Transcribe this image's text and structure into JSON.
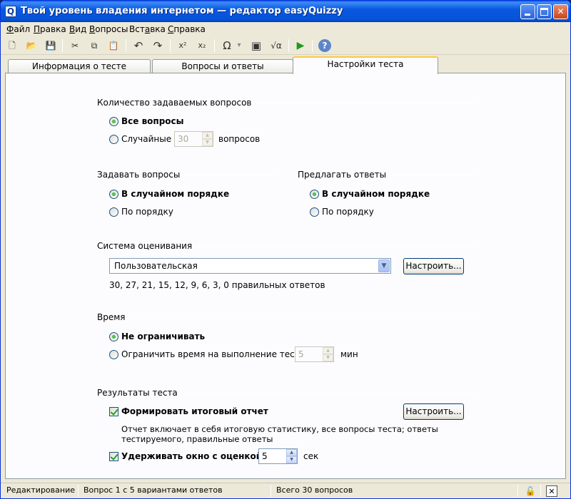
{
  "window": {
    "title": "Твой уровень владения интернетом — редактор easyQuizzy",
    "app_icon_letter": "Q"
  },
  "menu": {
    "items": [
      {
        "prefix": "",
        "ul": "Ф",
        "rest": "айл"
      },
      {
        "prefix": "",
        "ul": "П",
        "rest": "равка"
      },
      {
        "prefix": "",
        "ul": "В",
        "rest": "ид"
      },
      {
        "prefix": "",
        "ul": "В",
        "rest": "опросы"
      },
      {
        "prefix": "Вст",
        "ul": "а",
        "rest": "вка"
      },
      {
        "prefix": "",
        "ul": "С",
        "rest": "правка"
      }
    ]
  },
  "toolbar": {
    "icons": [
      "new-file-icon",
      "open-folder-icon",
      "save-icon",
      "cut-icon",
      "copy-icon",
      "paste-icon",
      "undo-icon",
      "redo-icon",
      "superscript-icon",
      "subscript-icon",
      "omega-symbol-icon",
      "insert-image-icon",
      "formula-icon",
      "run-test-icon",
      "help-icon"
    ],
    "glyphs": {
      "new": "🗋",
      "open": "📂",
      "save": "💾",
      "cut": "✂",
      "copy": "⧉",
      "paste": "📋",
      "undo": "↶",
      "redo": "↷",
      "sup": "x²",
      "sub": "x₂",
      "omega": "Ω",
      "omega_drop": "▾",
      "image": "▣",
      "formula": "√α",
      "run": "▶",
      "help": "?"
    }
  },
  "tabs": [
    {
      "label": "Информация о тесте",
      "active": false
    },
    {
      "label": "Вопросы и ответы",
      "active": false
    },
    {
      "label": "Настройки теста",
      "active": true
    }
  ],
  "settings": {
    "question_count": {
      "title": "Количество задаваемых вопросов",
      "all_label": "Все вопросы",
      "random_label": "Случайные",
      "random_value": "30",
      "random_suffix": "вопросов",
      "selected": "all"
    },
    "ask_questions": {
      "title": "Задавать вопросы",
      "random_label": "В случайном порядке",
      "ordered_label": "По порядку",
      "selected": "random"
    },
    "offer_answers": {
      "title": "Предлагать ответы",
      "random_label": "В случайном порядке",
      "ordered_label": "По порядку",
      "selected": "random"
    },
    "grading": {
      "title": "Система оценивания",
      "selected_value": "Пользовательская",
      "configure_label": "Настроить...",
      "thresholds_text": "30, 27, 21, 15, 12, 9, 6, 3, 0 правильных ответов"
    },
    "time": {
      "title": "Время",
      "unlimited_label": "Не ограничивать",
      "limit_label": "Ограничить время на выполнение теста",
      "limit_value": "5",
      "limit_unit": "мин",
      "selected": "unlimited"
    },
    "results": {
      "title": "Результаты теста",
      "report_label": "Формировать итоговый отчет",
      "report_checked": true,
      "configure_label": "Настроить...",
      "report_desc_line1": "Отчет включает в себя итоговую статистику, все вопросы теста; ответы",
      "report_desc_line2": "тестируемого, правильные ответы",
      "hold_label": "Удерживать окно с оценкой",
      "hold_checked": true,
      "hold_value": "5",
      "hold_unit": "сек"
    }
  },
  "status": {
    "mode": "Редактирование",
    "question_info": "Вопрос 1 с 5 вариантами ответов",
    "total": "Всего 30 вопросов"
  },
  "colors": {
    "titlebar": "#0553D8",
    "active_tab_accent": "#FFC83C",
    "radio_dot": "#21A121"
  }
}
